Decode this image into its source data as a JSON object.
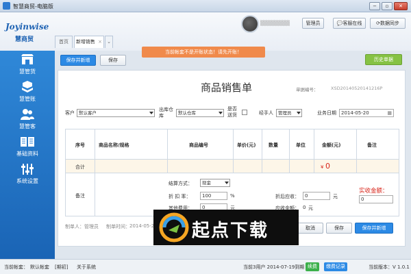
{
  "window": {
    "title": "智慧商贸-电脑版",
    "min": "−",
    "restore": "▫",
    "close": "✕"
  },
  "brand": {
    "logo_text": "Joyinwise",
    "logo_cn": "慧商贸"
  },
  "tabs": [
    {
      "label": "首页"
    },
    {
      "label": "新增销售"
    }
  ],
  "tab_close": "×",
  "tab_dropdown": "⌄",
  "header": {
    "role_button": "管理员",
    "service_button": "客服在线",
    "sync_button": "数据同步"
  },
  "sidebar": {
    "items": [
      {
        "label": "慧管货",
        "icon": "store-icon"
      },
      {
        "label": "慧管账",
        "icon": "ledger-icon"
      },
      {
        "label": "慧管客",
        "icon": "customers-icon"
      },
      {
        "label": "基础资料",
        "icon": "book-icon"
      },
      {
        "label": "系统设置",
        "icon": "settings-icon"
      }
    ]
  },
  "warning": "当前帐套不是开账状态！请先开账！",
  "toolbar": {
    "save_new": "保存并新增",
    "save": "保存",
    "history": "历史单据"
  },
  "doc": {
    "title": "商品销售单",
    "number_label": "单据编号：",
    "number": "XSD20140520141216P"
  },
  "form": {
    "customer_label": "客户",
    "customer_value": "默认客户",
    "warehouse_label": "出库仓库",
    "warehouse_value": "默认仓库",
    "delivery_label": "是否送货",
    "handler_label": "经手人",
    "handler_value": "管理员",
    "date_label": "业务日期",
    "date_value": "2014-05-20"
  },
  "grid": {
    "headers": [
      "序号",
      "商品名称/规格",
      "商品编号",
      "单价(元)",
      "数量",
      "单位",
      "金额(元)",
      "备注"
    ],
    "total_label": "合计",
    "total_currency": "¥",
    "total_value": "0",
    "remark_label": "备注",
    "settle_label": "结算方式：",
    "settle_value": "现金",
    "discount_label": "折 扣 率：",
    "discount_value": "100",
    "discount_unit": "%",
    "other_label": "其他费用：",
    "other_value": "0",
    "other_unit": "元",
    "after_discount_label": "折后应收：",
    "after_discount_value": "0",
    "after_discount_unit": "元",
    "due_label": "应收金额：",
    "due_value": "0",
    "due_unit": "元",
    "received_label": "实收金额：",
    "received_value": "0"
  },
  "footer": {
    "creator_label": "制单人：",
    "creator": "管理员",
    "created_time_label": "制单时间：",
    "created_time": "2014-05-2",
    "cancel": "取消",
    "save": "保存",
    "save_new": "保存并新增"
  },
  "statusbar": {
    "account_label": "当前帐套：",
    "account_value": "默认帐套",
    "period": "[期初]",
    "about": "关于系统",
    "trial": "当前3用户 2014-07-19到期",
    "renew": "续费",
    "renew_record": "缴费记录",
    "version": "当前版本：V 1.0.1"
  },
  "watermark": {
    "text": "起点下载"
  },
  "colors": {
    "sidebar": "#2a7fd4",
    "primary": "#2c8ae5",
    "warning": "#f08a4b",
    "accent_red": "#d8261b",
    "green": "#86c244"
  }
}
